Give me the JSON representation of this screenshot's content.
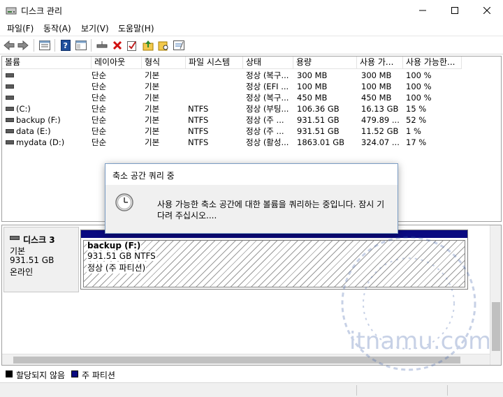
{
  "window": {
    "title": "디스크 관리",
    "icon": "disk-management-icon"
  },
  "menu": [
    "파일(F)",
    "동작(A)",
    "보기(V)",
    "도움말(H)"
  ],
  "toolbar": {
    "icons": [
      "back-arrow-icon",
      "forward-arrow-icon",
      "properties-list-icon",
      "help-icon",
      "console-tree-icon",
      "connect-disk-icon",
      "delete-icon",
      "check-icon",
      "folder-up-icon",
      "folder-search-icon",
      "edit-icon"
    ]
  },
  "volume_table": {
    "columns": [
      "볼륨",
      "레이아웃",
      "형식",
      "파일 시스템",
      "상태",
      "용량",
      "사용 가...",
      "사용 가능한..."
    ],
    "rows": [
      {
        "volume": "",
        "layout": "단순",
        "type": "기본",
        "fs": "",
        "status": "정상 (복구...",
        "capacity": "300 MB",
        "free": "300 MB",
        "pct": "100 %"
      },
      {
        "volume": "",
        "layout": "단순",
        "type": "기본",
        "fs": "",
        "status": "정상 (EFI ...",
        "capacity": "100 MB",
        "free": "100 MB",
        "pct": "100 %"
      },
      {
        "volume": "",
        "layout": "단순",
        "type": "기본",
        "fs": "",
        "status": "정상 (복구...",
        "capacity": "450 MB",
        "free": "450 MB",
        "pct": "100 %"
      },
      {
        "volume": "(C:)",
        "layout": "단순",
        "type": "기본",
        "fs": "NTFS",
        "status": "정상 (부팅...",
        "capacity": "106.36 GB",
        "free": "16.13 GB",
        "pct": "15 %"
      },
      {
        "volume": "backup (F:)",
        "layout": "단순",
        "type": "기본",
        "fs": "NTFS",
        "status": "정상 (주 ...",
        "capacity": "931.51 GB",
        "free": "479.89 ...",
        "pct": "52 %"
      },
      {
        "volume": "data (E:)",
        "layout": "단순",
        "type": "기본",
        "fs": "NTFS",
        "status": "정상 (주 ...",
        "capacity": "931.51 GB",
        "free": "11.52 GB",
        "pct": "1 %"
      },
      {
        "volume": "mydata (D:)",
        "layout": "단순",
        "type": "기본",
        "fs": "NTFS",
        "status": "정상 (활성...",
        "capacity": "1863.01 GB",
        "free": "324.07 ...",
        "pct": "17 %"
      }
    ]
  },
  "disk": {
    "name": "디스크 3",
    "type": "기본",
    "size": "931.51 GB",
    "state": "온라인",
    "partition": {
      "name": "backup  (F:)",
      "size_fs": "931.51 GB NTFS",
      "status": "정상 (주 파티션)"
    }
  },
  "legend": [
    {
      "label": "할당되지 않음",
      "color": "#000000"
    },
    {
      "label": "주 파티션",
      "color": "#0a0a80"
    }
  ],
  "dialog": {
    "title": "축소 공간 쿼리 중",
    "icon": "clock-icon",
    "message_line1": "사용 가능한 축소 공간에 대한 볼륨을 쿼리하는 중입니다. 잠시 기",
    "message_line2": "다려 주십시오...."
  },
  "watermark": {
    "text": "itnamu.com"
  }
}
